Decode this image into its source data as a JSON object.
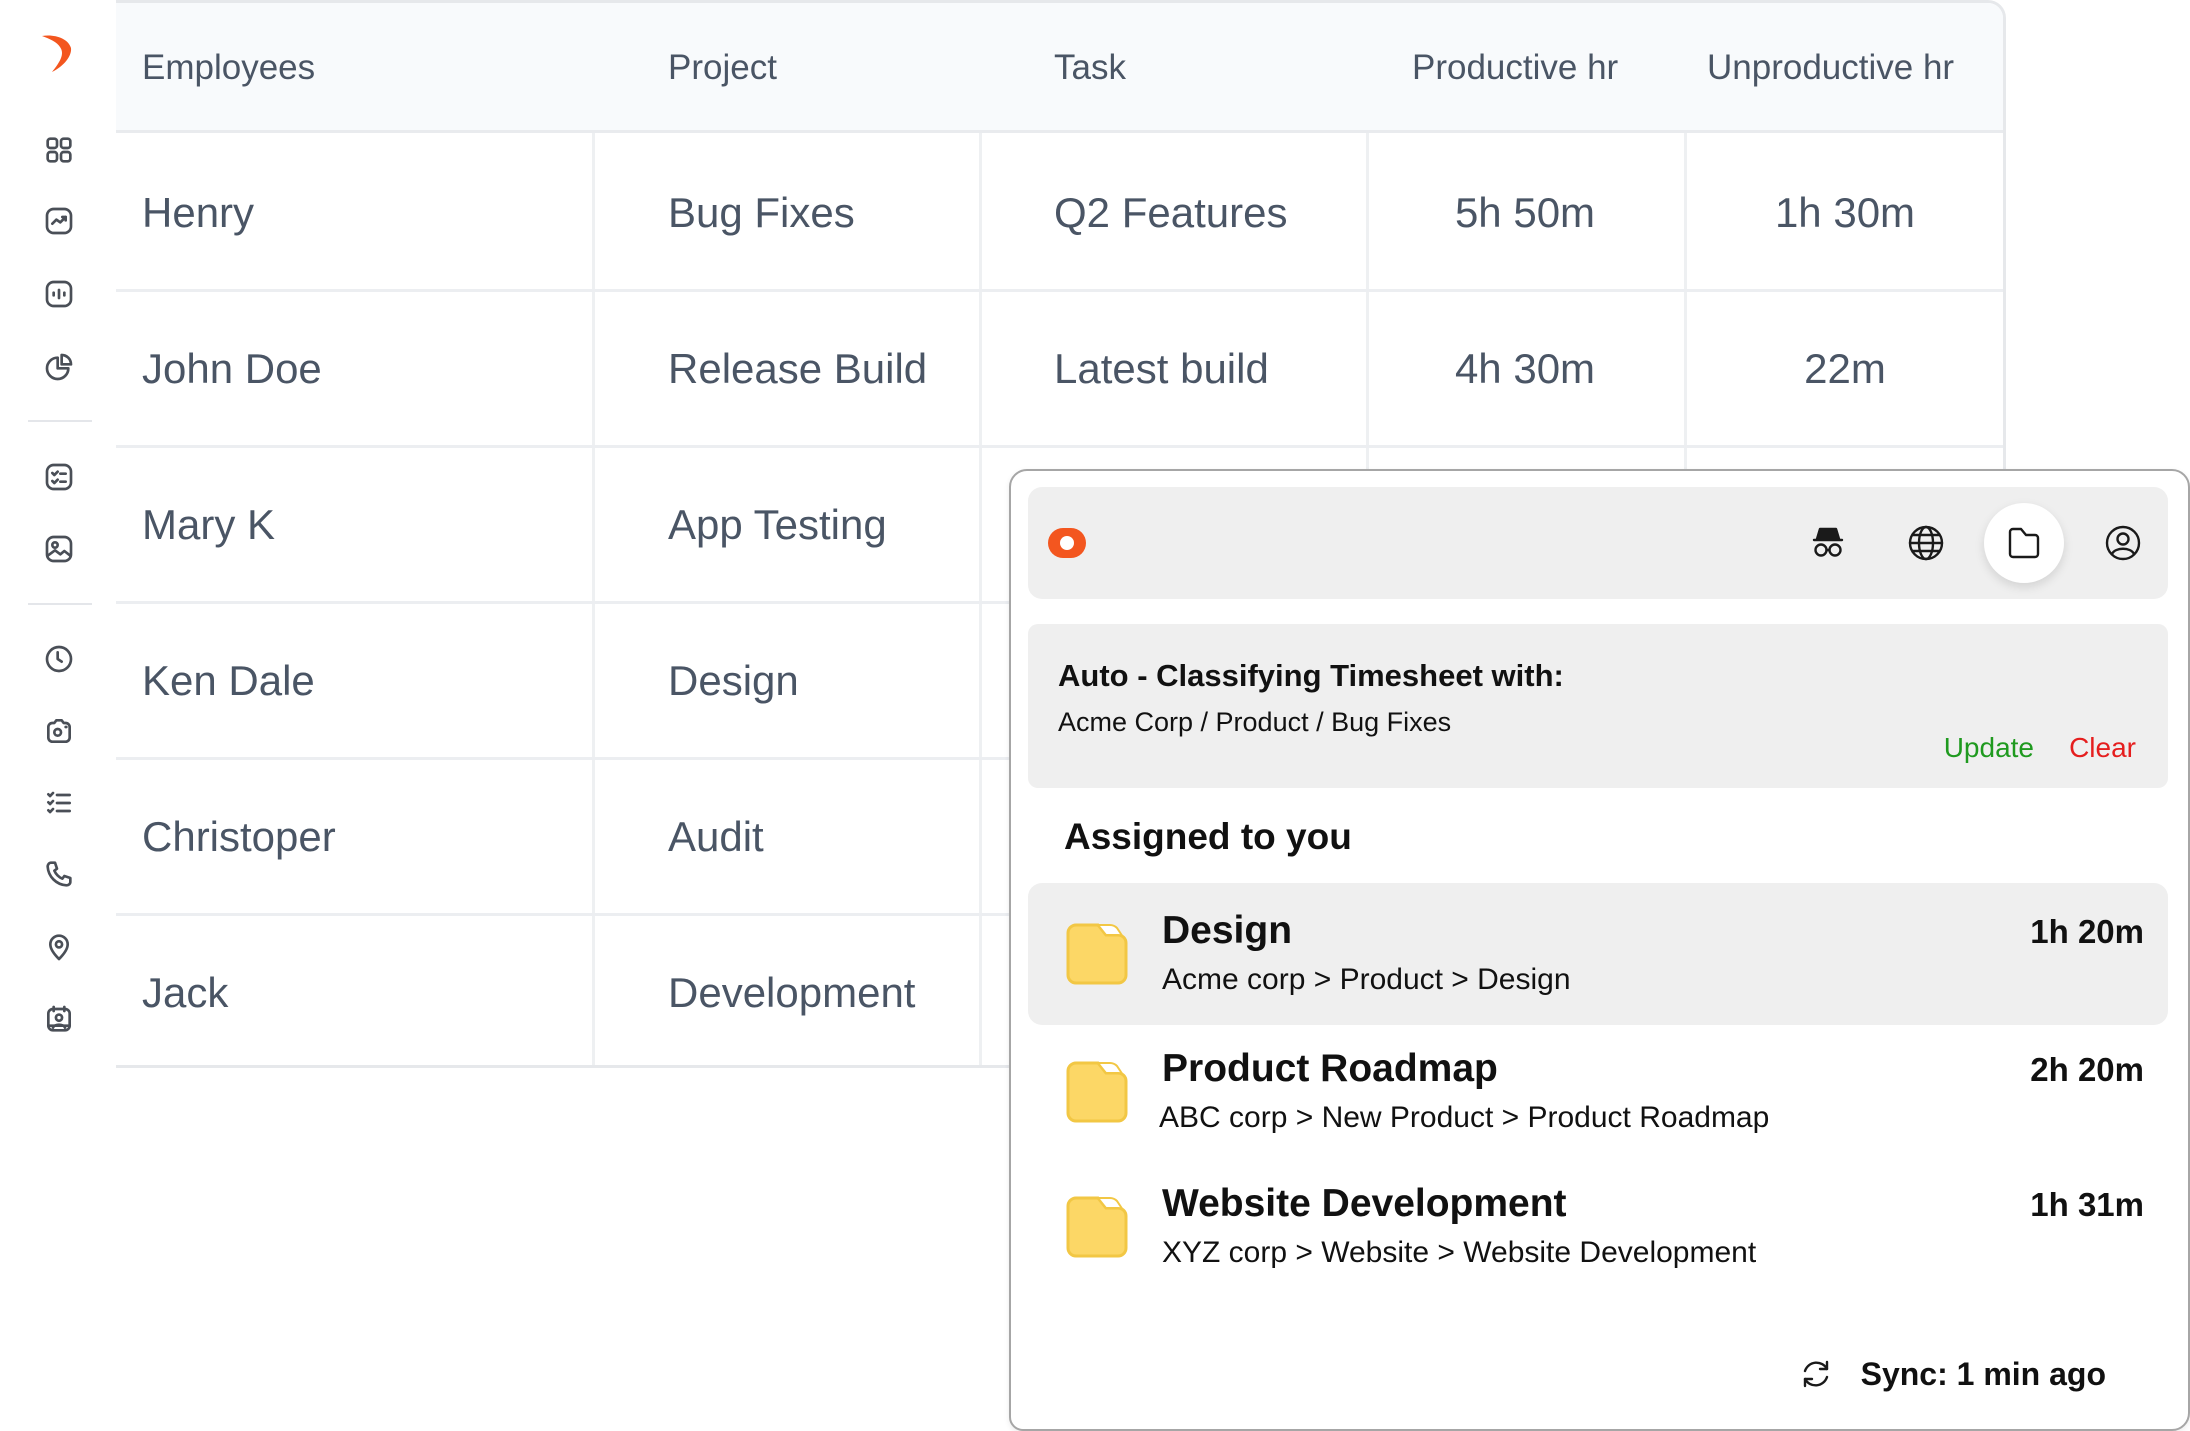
{
  "brand": {
    "accent": "#f3561f",
    "logo_icon": "app-logo-icon"
  },
  "sidebar": {
    "groups": [
      [
        {
          "icon": "dashboard-grid-icon"
        },
        {
          "icon": "trend-chart-icon"
        },
        {
          "icon": "bar-meter-icon"
        },
        {
          "icon": "pie-chart-icon"
        }
      ],
      [
        {
          "icon": "checklist-icon"
        },
        {
          "icon": "image-gallery-icon"
        }
      ],
      [
        {
          "icon": "clock-icon"
        },
        {
          "icon": "camera-icon"
        },
        {
          "icon": "task-list-icon"
        },
        {
          "icon": "phone-icon"
        },
        {
          "icon": "location-pin-icon"
        },
        {
          "icon": "contact-badge-icon"
        }
      ]
    ]
  },
  "table": {
    "columns": [
      "Employees",
      "Project",
      "Task",
      "Productive hr",
      "Unproductive hr"
    ],
    "rows": [
      [
        "Henry",
        "Bug Fixes",
        "Q2 Features",
        "5h 50m",
        "1h 30m"
      ],
      [
        "John Doe",
        "Release Build",
        "Latest build",
        "4h 30m",
        "22m"
      ],
      [
        "Mary K",
        "App Testing",
        "",
        "",
        ""
      ],
      [
        "Ken Dale",
        "Design",
        "",
        "",
        ""
      ],
      [
        "Christoper",
        "Audit",
        "",
        "",
        ""
      ],
      [
        "Jack",
        "Development",
        "",
        "",
        ""
      ]
    ]
  },
  "popup": {
    "toolbar": {
      "tracking_toggle": "on",
      "icons": [
        "incognito-icon",
        "globe-icon",
        "folder-icon",
        "user-circle-icon"
      ],
      "active_icon": "folder-icon"
    },
    "classify": {
      "title": "Auto - Classifying Timesheet with:",
      "path": "Acme Corp / Product / Bug Fixes",
      "update_label": "Update",
      "clear_label": "Clear",
      "update_color": "#1f9a1f",
      "clear_color": "#e51e1e"
    },
    "assigned_title": "Assigned to you",
    "items": [
      {
        "name": "Design",
        "path": "Acme corp > Product > Design",
        "time": "1h 20m",
        "highlighted": true
      },
      {
        "name": "Product Roadmap",
        "path": "ABC corp > New Product > Product Roadmap",
        "time": "2h 20m",
        "highlighted": false
      },
      {
        "name": "Website Development",
        "path": "XYZ corp > Website > Website Development",
        "time": "1h 31m",
        "highlighted": false
      }
    ],
    "sync_text": "Sync: 1 min ago"
  }
}
